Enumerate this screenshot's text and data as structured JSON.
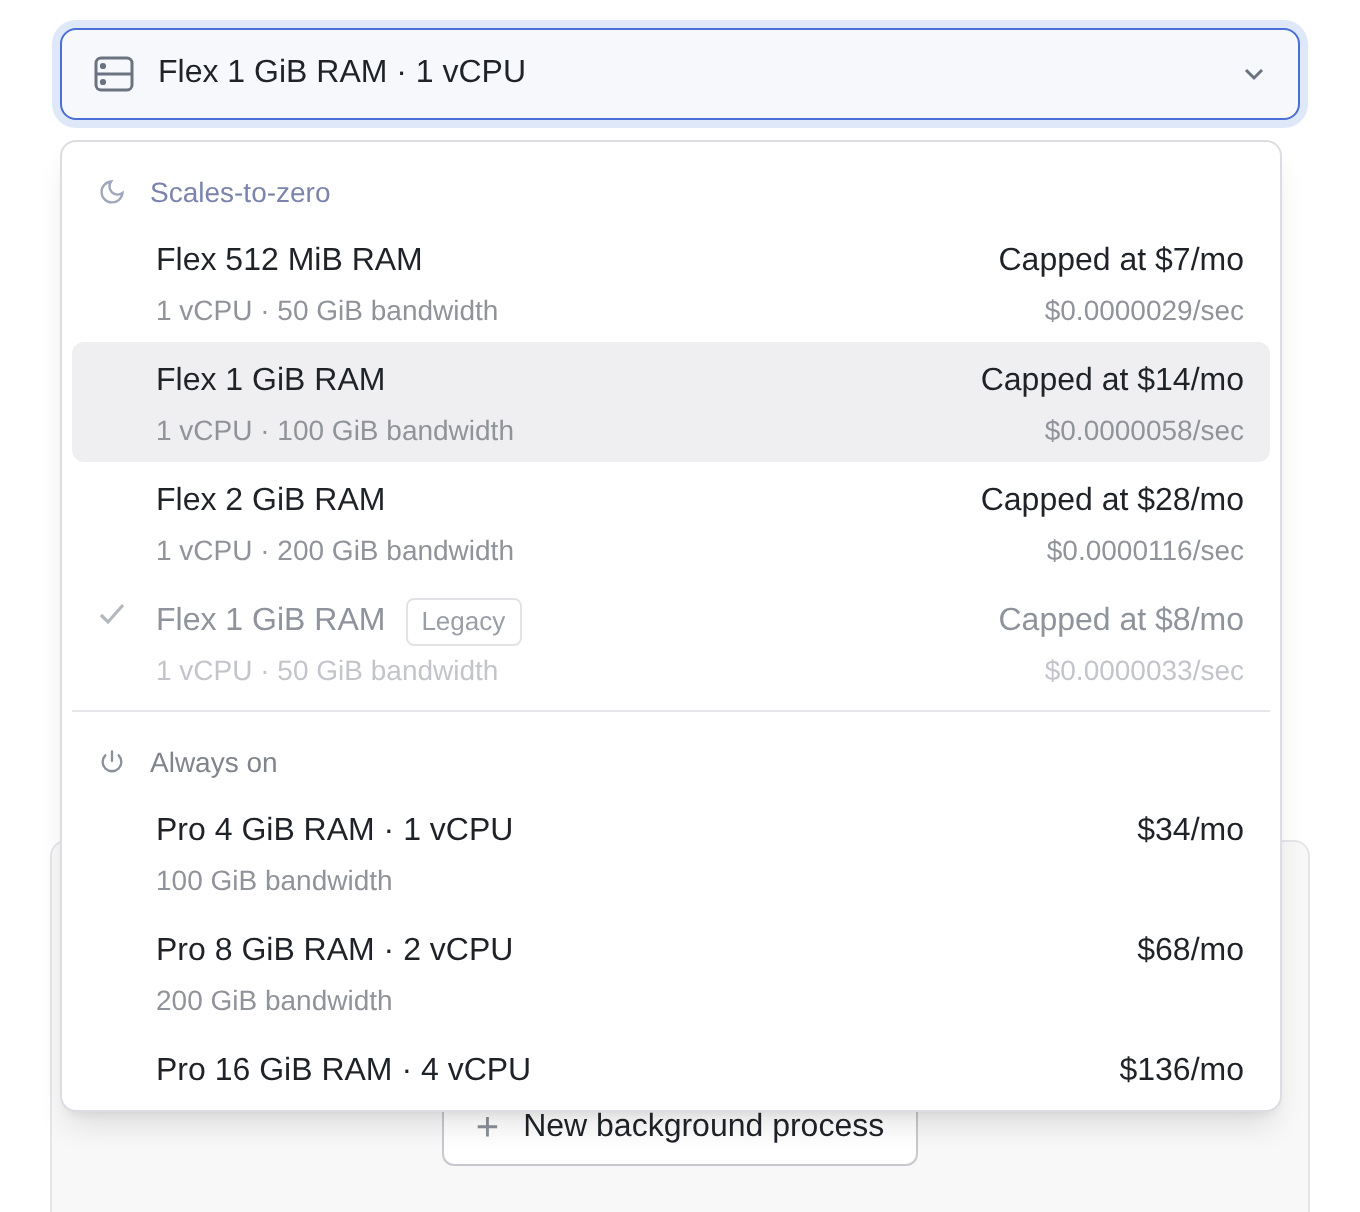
{
  "select": {
    "value": "Flex 1 GiB RAM · 1 vCPU",
    "expanded": true
  },
  "groups": [
    {
      "label": "Scales-to-zero",
      "kind": "moon",
      "items": [
        {
          "name": "Flex 512 MiB RAM",
          "detail": "1 vCPU · 50 GiB bandwidth",
          "price": "Capped at $7/mo",
          "rate": "$0.0000029/sec",
          "selected": false,
          "checked": false,
          "disabled": false
        },
        {
          "name": "Flex 1 GiB RAM",
          "detail": "1 vCPU · 100 GiB bandwidth",
          "price": "Capped at $14/mo",
          "rate": "$0.0000058/sec",
          "selected": true,
          "checked": false,
          "disabled": false
        },
        {
          "name": "Flex 2 GiB RAM",
          "detail": "1 vCPU · 200 GiB bandwidth",
          "price": "Capped at $28/mo",
          "rate": "$0.0000116/sec",
          "selected": false,
          "checked": false,
          "disabled": false
        },
        {
          "name": "Flex 1 GiB RAM",
          "badge": "Legacy",
          "detail": "1 vCPU · 50 GiB bandwidth",
          "price": "Capped at $8/mo",
          "rate": "$0.0000033/sec",
          "selected": false,
          "checked": true,
          "disabled": true
        }
      ]
    },
    {
      "label": "Always on",
      "kind": "power",
      "items": [
        {
          "name": "Pro 4 GiB RAM · 1 vCPU",
          "detail": "100 GiB bandwidth",
          "price": "$34/mo",
          "selected": false,
          "checked": false,
          "disabled": false
        },
        {
          "name": "Pro 8 GiB RAM · 2 vCPU",
          "detail": "200 GiB bandwidth",
          "price": "$68/mo",
          "selected": false,
          "checked": false,
          "disabled": false
        },
        {
          "name": "Pro 16 GiB RAM · 4 vCPU",
          "price": "$136/mo",
          "selected": false,
          "checked": false,
          "disabled": false
        }
      ]
    }
  ],
  "background_button": {
    "icon": "+",
    "label": "New background process"
  }
}
